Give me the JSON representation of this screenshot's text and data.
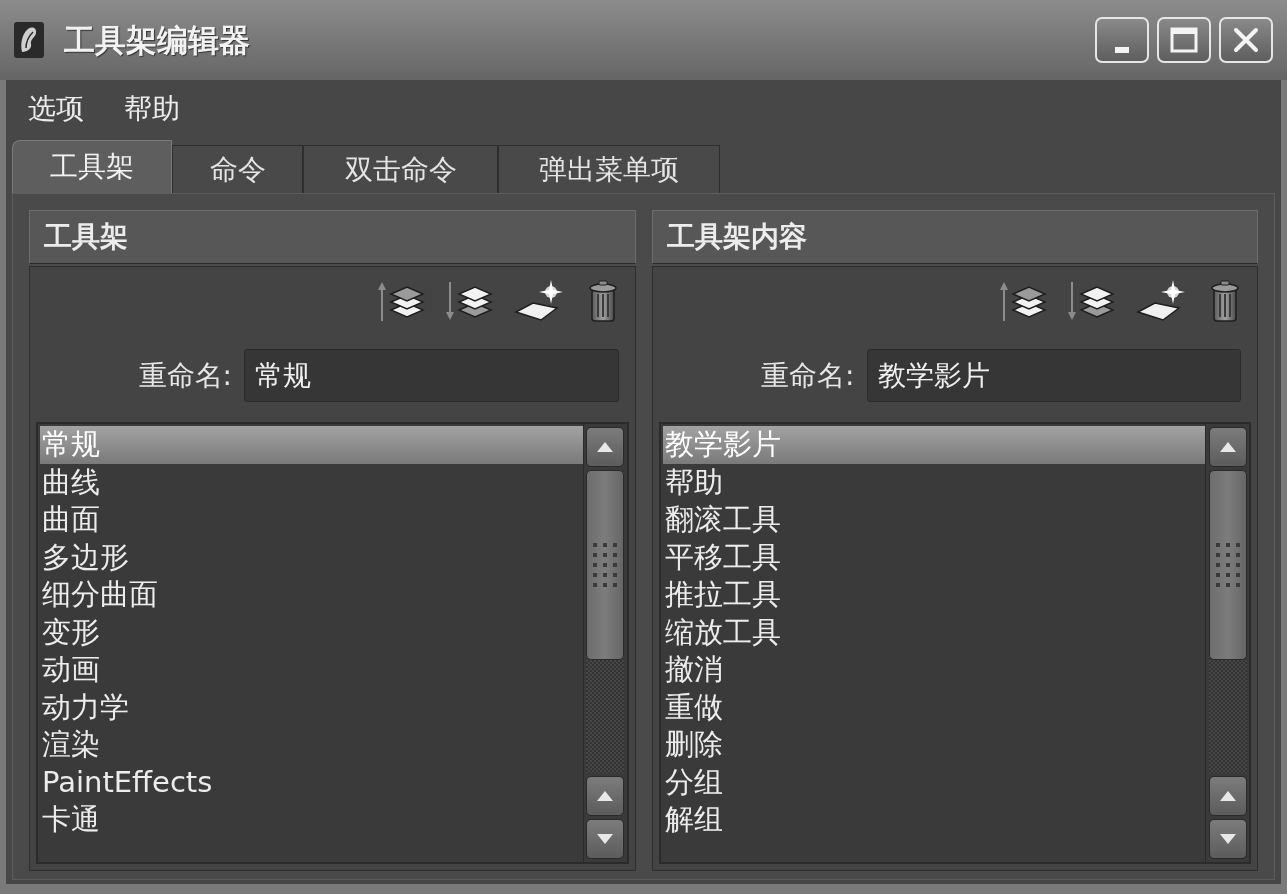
{
  "window": {
    "title": "工具架编辑器"
  },
  "menu": [
    "选项",
    "帮助"
  ],
  "tabs": [
    {
      "label": "工具架",
      "selected": true
    },
    {
      "label": "命令",
      "selected": false
    },
    {
      "label": "双击命令",
      "selected": false
    },
    {
      "label": "弹出菜单项",
      "selected": false
    }
  ],
  "panels": [
    {
      "title": "工具架",
      "rename": {
        "label": "重命名:",
        "value": "常规"
      },
      "items": [
        {
          "label": "常规",
          "selected": true
        },
        {
          "label": "曲线",
          "selected": false
        },
        {
          "label": "曲面",
          "selected": false
        },
        {
          "label": "多边形",
          "selected": false
        },
        {
          "label": "细分曲面",
          "selected": false
        },
        {
          "label": "变形",
          "selected": false
        },
        {
          "label": "动画",
          "selected": false
        },
        {
          "label": "动力学",
          "selected": false
        },
        {
          "label": "渲染",
          "selected": false
        },
        {
          "label": "PaintEffects",
          "selected": false
        },
        {
          "label": "卡通",
          "selected": false
        }
      ]
    },
    {
      "title": "工具架内容",
      "rename": {
        "label": "重命名:",
        "value": "教学影片"
      },
      "items": [
        {
          "label": "教学影片",
          "selected": true
        },
        {
          "label": "帮助",
          "selected": false
        },
        {
          "label": "翻滚工具",
          "selected": false
        },
        {
          "label": "平移工具",
          "selected": false
        },
        {
          "label": "推拉工具",
          "selected": false
        },
        {
          "label": "缩放工具",
          "selected": false
        },
        {
          "label": "撤消",
          "selected": false
        },
        {
          "label": "重做",
          "selected": false
        },
        {
          "label": "删除",
          "selected": false
        },
        {
          "label": "分组",
          "selected": false
        },
        {
          "label": "解组",
          "selected": false
        }
      ]
    }
  ]
}
